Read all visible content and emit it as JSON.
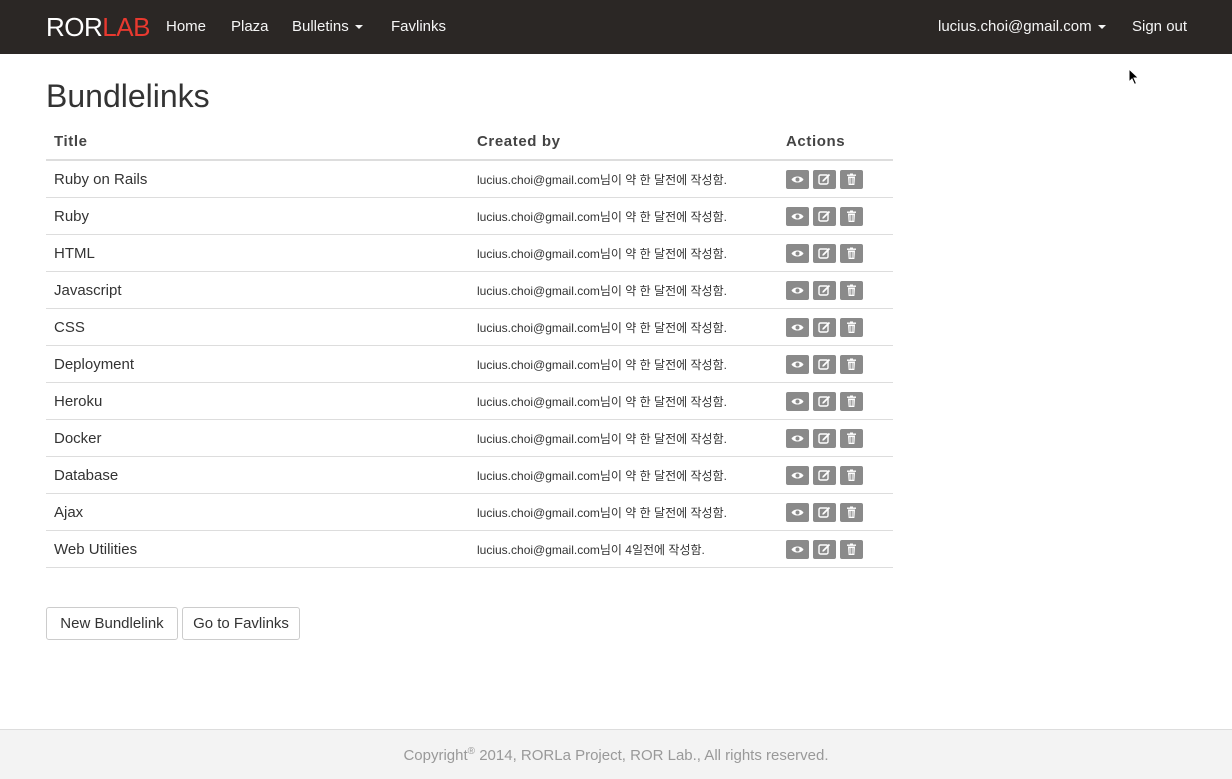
{
  "navbar": {
    "brand_main": "ROR",
    "brand_accent": "LAB",
    "items": [
      {
        "label": "Home"
      },
      {
        "label": "Plaza"
      },
      {
        "label": "Bulletins"
      },
      {
        "label": "Favlinks"
      }
    ],
    "user_email": "lucius.choi@gmail.com",
    "sign_out": "Sign out"
  },
  "page": {
    "title": "Bundlelinks"
  },
  "table": {
    "headers": [
      "Title",
      "Created by",
      "Actions"
    ],
    "rows": [
      {
        "title": "Ruby on Rails",
        "created_by": "lucius.choi@gmail.com님이 약 한 달전에 작성함."
      },
      {
        "title": "Ruby",
        "created_by": "lucius.choi@gmail.com님이 약 한 달전에 작성함."
      },
      {
        "title": "HTML",
        "created_by": "lucius.choi@gmail.com님이 약 한 달전에 작성함."
      },
      {
        "title": "Javascript",
        "created_by": "lucius.choi@gmail.com님이 약 한 달전에 작성함."
      },
      {
        "title": "CSS",
        "created_by": "lucius.choi@gmail.com님이 약 한 달전에 작성함."
      },
      {
        "title": "Deployment",
        "created_by": "lucius.choi@gmail.com님이 약 한 달전에 작성함."
      },
      {
        "title": "Heroku",
        "created_by": "lucius.choi@gmail.com님이 약 한 달전에 작성함."
      },
      {
        "title": "Docker",
        "created_by": "lucius.choi@gmail.com님이 약 한 달전에 작성함."
      },
      {
        "title": "Database",
        "created_by": "lucius.choi@gmail.com님이 약 한 달전에 작성함."
      },
      {
        "title": "Ajax",
        "created_by": "lucius.choi@gmail.com님이 약 한 달전에 작성함."
      },
      {
        "title": "Web Utilities",
        "created_by": "lucius.choi@gmail.com님이 4일전에 작성함."
      }
    ],
    "action_icons": [
      "eye-icon",
      "edit-icon",
      "trash-icon"
    ]
  },
  "buttons": {
    "new_bundlelink": "New Bundlelink",
    "go_to_favlinks": "Go to Favlinks"
  },
  "footer": {
    "prefix": "Copyright",
    "mark": "®",
    "suffix": " 2014, RORLa Project, ROR Lab., All rights reserved."
  },
  "colors": {
    "navbar_bg": "#2b2725",
    "brand_accent": "#e8392f",
    "action_button": "#8a8a8a",
    "footer_bg": "#f3f3f3"
  }
}
